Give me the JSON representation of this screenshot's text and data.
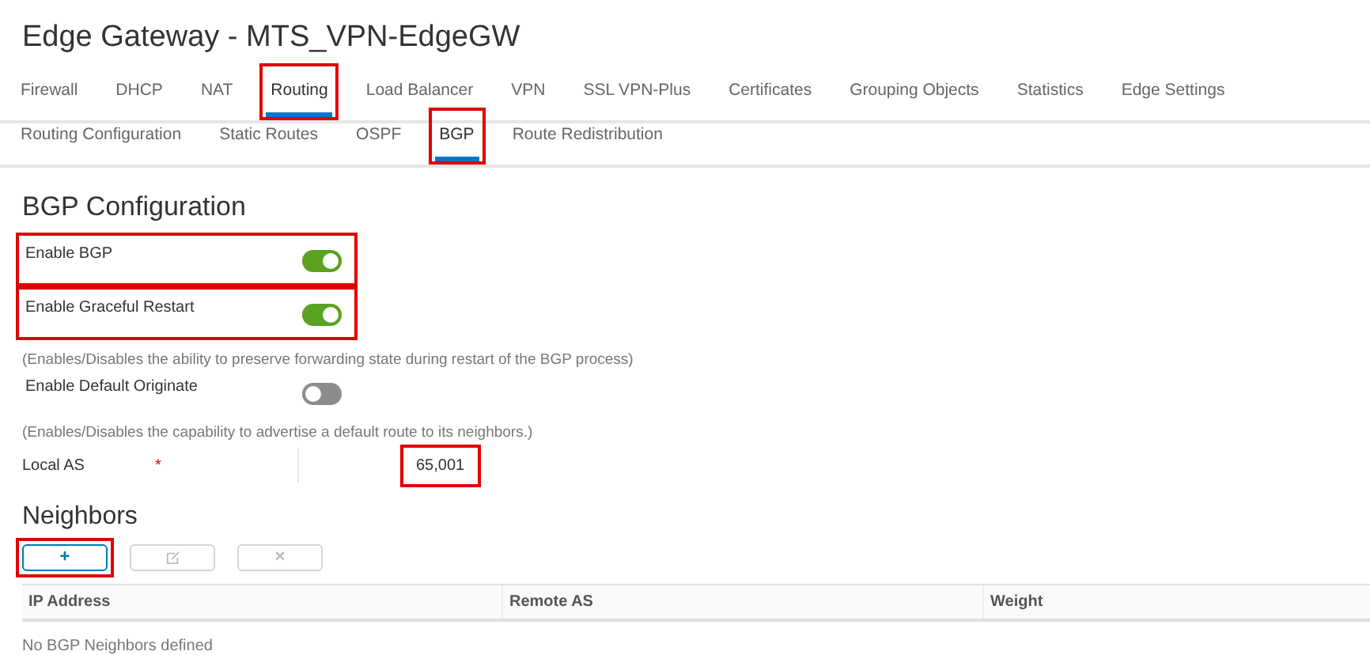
{
  "title": "Edge Gateway - MTS_VPN-EdgeGW",
  "tabs": [
    {
      "label": "Firewall",
      "selected": false,
      "highlighted": false
    },
    {
      "label": "DHCP",
      "selected": false,
      "highlighted": false
    },
    {
      "label": "NAT",
      "selected": false,
      "highlighted": false
    },
    {
      "label": "Routing",
      "selected": true,
      "highlighted": true
    },
    {
      "label": "Load Balancer",
      "selected": false,
      "highlighted": false
    },
    {
      "label": "VPN",
      "selected": false,
      "highlighted": false
    },
    {
      "label": "SSL VPN-Plus",
      "selected": false,
      "highlighted": false
    },
    {
      "label": "Certificates",
      "selected": false,
      "highlighted": false
    },
    {
      "label": "Grouping Objects",
      "selected": false,
      "highlighted": false
    },
    {
      "label": "Statistics",
      "selected": false,
      "highlighted": false
    },
    {
      "label": "Edge Settings",
      "selected": false,
      "highlighted": false
    }
  ],
  "subtabs": [
    {
      "label": "Routing Configuration",
      "selected": false,
      "highlighted": false
    },
    {
      "label": "Static Routes",
      "selected": false,
      "highlighted": false
    },
    {
      "label": "OSPF",
      "selected": false,
      "highlighted": false
    },
    {
      "label": "BGP",
      "selected": true,
      "highlighted": true
    },
    {
      "label": "Route Redistribution",
      "selected": false,
      "highlighted": false
    }
  ],
  "section_title": "BGP Configuration",
  "settings": [
    {
      "label": "Enable BGP",
      "on": true,
      "highlighted": true
    },
    {
      "label": "Enable Graceful Restart",
      "on": true,
      "highlighted": true,
      "note": "(Enables/Disables the ability to preserve forwarding state during restart of the BGP process)"
    },
    {
      "label": "Enable Default Originate",
      "on": false,
      "highlighted": false,
      "note": "(Enables/Disables the capability to advertise a default route to its neighbors.)"
    }
  ],
  "local_as": {
    "label": "Local AS",
    "required_mark": "*",
    "value": "65,001",
    "highlighted": true
  },
  "neighbors": {
    "title": "Neighbors",
    "buttons": [
      {
        "kind": "add",
        "label": "+",
        "disabled": false,
        "highlighted": true
      },
      {
        "kind": "edit",
        "disabled": true,
        "highlighted": false
      },
      {
        "kind": "delete",
        "label": "×",
        "disabled": true,
        "highlighted": false
      }
    ],
    "columns": [
      "IP Address",
      "Remote AS",
      "Weight"
    ],
    "empty_text": "No BGP Neighbors defined"
  }
}
